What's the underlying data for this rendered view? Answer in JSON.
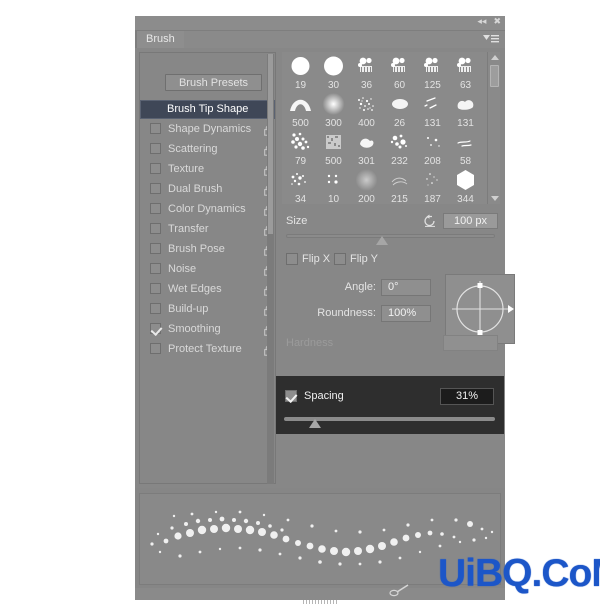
{
  "window": {
    "title_bar_icons": [
      "collapse-icon",
      "close-icon"
    ],
    "tab_label": "Brush",
    "panel_menu_icon": "panel-menu-icon"
  },
  "left_panel": {
    "presets_button": "Brush Presets",
    "options": [
      {
        "label": "Brush Tip Shape",
        "selected": true,
        "checkbox": false,
        "checked": false,
        "lock": false
      },
      {
        "label": "Shape Dynamics",
        "selected": false,
        "checkbox": true,
        "checked": false,
        "lock": true
      },
      {
        "label": "Scattering",
        "selected": false,
        "checkbox": true,
        "checked": false,
        "lock": true
      },
      {
        "label": "Texture",
        "selected": false,
        "checkbox": true,
        "checked": false,
        "lock": true
      },
      {
        "label": "Dual Brush",
        "selected": false,
        "checkbox": true,
        "checked": false,
        "lock": true
      },
      {
        "label": "Color Dynamics",
        "selected": false,
        "checkbox": true,
        "checked": false,
        "lock": true
      },
      {
        "label": "Transfer",
        "selected": false,
        "checkbox": true,
        "checked": false,
        "lock": true
      },
      {
        "label": "Brush Pose",
        "selected": false,
        "checkbox": true,
        "checked": false,
        "lock": true
      },
      {
        "label": "Noise",
        "selected": false,
        "checkbox": true,
        "checked": false,
        "lock": true
      },
      {
        "label": "Wet Edges",
        "selected": false,
        "checkbox": true,
        "checked": false,
        "lock": true
      },
      {
        "label": "Build-up",
        "selected": false,
        "checkbox": true,
        "checked": false,
        "lock": true
      },
      {
        "label": "Smoothing",
        "selected": false,
        "checkbox": true,
        "checked": true,
        "lock": true
      },
      {
        "label": "Protect Texture",
        "selected": false,
        "checkbox": true,
        "checked": false,
        "lock": true
      }
    ]
  },
  "brush_grid": {
    "columns": 6,
    "tips": [
      {
        "size": "19",
        "shape": "round-soft"
      },
      {
        "size": "30",
        "shape": "round-soft"
      },
      {
        "size": "36",
        "shape": "textured"
      },
      {
        "size": "60",
        "shape": "textured"
      },
      {
        "size": "125",
        "shape": "textured"
      },
      {
        "size": "63",
        "shape": "textured"
      },
      {
        "size": "500",
        "shape": "arch"
      },
      {
        "size": "300",
        "shape": "soft-glow"
      },
      {
        "size": "400",
        "shape": "speckle"
      },
      {
        "size": "26",
        "shape": "blob"
      },
      {
        "size": "131",
        "shape": "streaks"
      },
      {
        "size": "131",
        "shape": "cloud"
      },
      {
        "size": "79",
        "shape": "dots"
      },
      {
        "size": "500",
        "shape": "grain"
      },
      {
        "size": "301",
        "shape": "splash"
      },
      {
        "size": "232",
        "shape": "scatter"
      },
      {
        "size": "208",
        "shape": "sparse"
      },
      {
        "size": "58",
        "shape": "flick"
      },
      {
        "size": "34",
        "shape": "spatter"
      },
      {
        "size": "10",
        "shape": "dots-small"
      },
      {
        "size": "200",
        "shape": "soft-blur"
      },
      {
        "size": "215",
        "shape": "wisp"
      },
      {
        "size": "187",
        "shape": "fine-dots"
      },
      {
        "size": "344",
        "shape": "hexagon"
      }
    ],
    "scrollbar": {
      "up_arrow_icon": "scroll-up-arrow-icon",
      "down_arrow_icon": "scroll-down-arrow-icon"
    }
  },
  "controls": {
    "size_label": "Size",
    "size_value": "100 px",
    "size_reset_icon": "reset-size-icon",
    "size_slider_percent": 48,
    "flip_x_label": "Flip X",
    "flip_x_checked": false,
    "flip_y_label": "Flip Y",
    "flip_y_checked": false,
    "angle_label": "Angle:",
    "angle_value": "0°",
    "roundness_label": "Roundness:",
    "roundness_value": "100%",
    "hardness_label": "Hardness",
    "hardness_value": "",
    "hardness_disabled": true,
    "angle_pad_icon": "angle-roundness-pad-icon"
  },
  "spacing": {
    "label": "Spacing",
    "checked": true,
    "value": "31%",
    "slider_percent": 16,
    "highlight_color": "#2e2e2e"
  },
  "preview": {
    "label": "brush-stroke-preview"
  },
  "footer": {
    "new_brush_icon": "create-new-brush-icon"
  },
  "watermark": {
    "text": "UiBQ.CoM",
    "color": "#1c56c8"
  }
}
